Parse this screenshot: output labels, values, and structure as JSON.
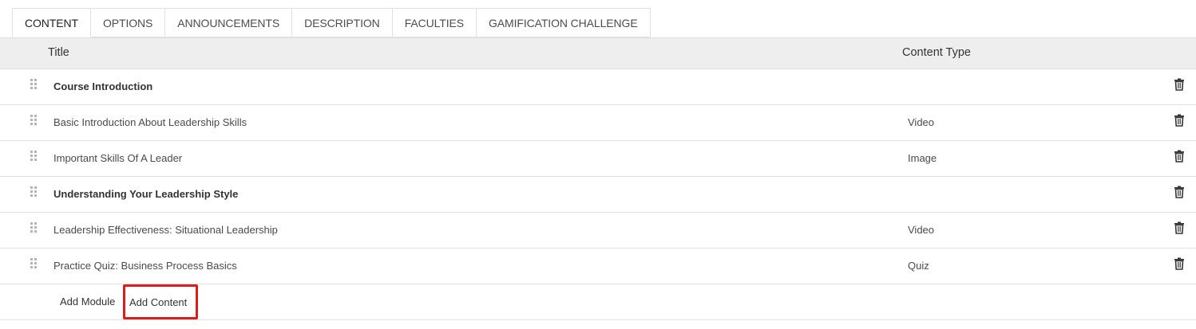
{
  "tabs": [
    {
      "label": "CONTENT",
      "active": true
    },
    {
      "label": "OPTIONS"
    },
    {
      "label": "ANNOUNCEMENTS"
    },
    {
      "label": "DESCRIPTION"
    },
    {
      "label": "FACULTIES"
    },
    {
      "label": "GAMIFICATION CHALLENGE"
    }
  ],
  "table": {
    "headers": {
      "title": "Title",
      "content_type": "Content Type"
    },
    "rows": [
      {
        "title": "Course Introduction",
        "type": "",
        "module": true
      },
      {
        "title": "Basic Introduction About Leadership Skills",
        "type": "Video"
      },
      {
        "title": "Important Skills Of A Leader",
        "type": "Image"
      },
      {
        "title": "Understanding Your Leadership Style",
        "type": "",
        "module": true
      },
      {
        "title": "Leadership Effectiveness: Situational Leadership",
        "type": "Video"
      },
      {
        "title": "Practice Quiz: Business Process Basics",
        "type": "Quiz"
      }
    ]
  },
  "footer": {
    "add_module": "Add Module",
    "add_content": "Add Content",
    "highlight_color": "#e01b1b"
  },
  "icons": {
    "drag": "drag-handle-icon",
    "delete": "trash-icon"
  }
}
